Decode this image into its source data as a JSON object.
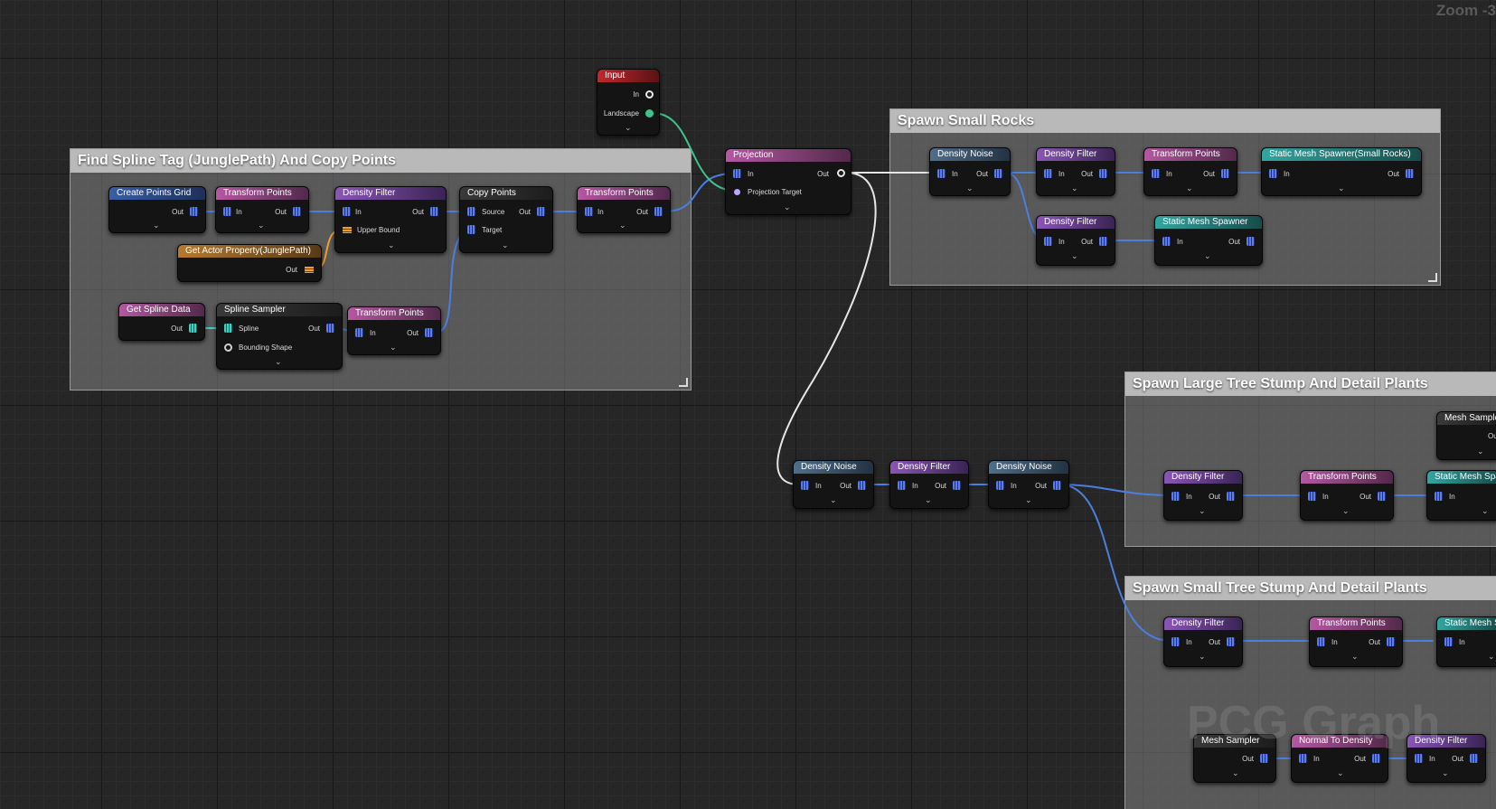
{
  "viewport": {
    "zoom_label": "Zoom -3",
    "watermark": "PCG Graph"
  },
  "colors": {
    "wire_spatial": "#4a7fe0",
    "wire_white": "#e6e6e6",
    "wire_green": "#3ec48a",
    "wire_orange": "#f0a028",
    "comment_bg": "#848484",
    "comment_title": "#b9b9b9"
  },
  "comments": [
    {
      "id": "c1",
      "title": "Find Spline Tag (JunglePath) And Copy Points"
    },
    {
      "id": "c2",
      "title": "Spawn Small Rocks"
    },
    {
      "id": "c3",
      "title": "Spawn Large Tree Stump And Detail Plants"
    },
    {
      "id": "c4",
      "title": "Spawn Small Tree Stump And Detail Plants"
    }
  ],
  "nodes": {
    "input": {
      "title": "Input",
      "pins": [
        "In",
        "Landscape"
      ]
    },
    "create_points_grid": {
      "title": "Create Points Grid",
      "pins": [
        "Out"
      ]
    },
    "transform_points_1": {
      "title": "Transform Points",
      "pins": [
        "In",
        "Out"
      ]
    },
    "density_filter_1": {
      "title": "Density Filter",
      "pins": [
        "In",
        "Out",
        "Upper Bound"
      ]
    },
    "copy_points": {
      "title": "Copy Points",
      "pins": [
        "Source",
        "Out",
        "Target"
      ]
    },
    "transform_points_2": {
      "title": "Transform Points",
      "pins": [
        "In",
        "Out"
      ]
    },
    "get_actor_property": {
      "title": "Get Actor Property(JunglePath)",
      "pins": [
        "Out"
      ]
    },
    "get_spline_data": {
      "title": "Get Spline Data",
      "pins": [
        "Out"
      ]
    },
    "spline_sampler": {
      "title": "Spline Sampler",
      "pins": [
        "Spline",
        "Out",
        "Bounding Shape"
      ]
    },
    "transform_points_3": {
      "title": "Transform Points",
      "pins": [
        "In",
        "Out"
      ]
    },
    "projection": {
      "title": "Projection",
      "pins": [
        "In",
        "Out",
        "Projection Target"
      ]
    },
    "sr_density_noise": {
      "title": "Density Noise",
      "pins": [
        "In",
        "Out"
      ]
    },
    "sr_density_filter_1": {
      "title": "Density Filter",
      "pins": [
        "In",
        "Out"
      ]
    },
    "sr_transform_points": {
      "title": "Transform Points",
      "pins": [
        "In",
        "Out"
      ]
    },
    "sr_static_mesh_spawner_rocks": {
      "title": "Static Mesh Spawner(Small Rocks)",
      "pins": [
        "In",
        "Out"
      ]
    },
    "sr_density_filter_2": {
      "title": "Density Filter",
      "pins": [
        "In",
        "Out"
      ]
    },
    "sr_static_mesh_spawner": {
      "title": "Static Mesh Spawner",
      "pins": [
        "In",
        "Out"
      ]
    },
    "m_density_noise_1": {
      "title": "Density Noise",
      "pins": [
        "In",
        "Out"
      ]
    },
    "m_density_filter": {
      "title": "Density Filter",
      "pins": [
        "In",
        "Out"
      ]
    },
    "m_density_noise_2": {
      "title": "Density Noise",
      "pins": [
        "In",
        "Out"
      ]
    },
    "lt_mesh_sampler": {
      "title": "Mesh Sampler",
      "pins": [
        "Out"
      ]
    },
    "lt_density_filter": {
      "title": "Density Filter",
      "pins": [
        "In",
        "Out"
      ]
    },
    "lt_transform_points": {
      "title": "Transform Points",
      "pins": [
        "In",
        "Out"
      ]
    },
    "lt_static_mesh_spawner": {
      "title": "Static Mesh Spawner",
      "pins": [
        "In"
      ]
    },
    "st_density_filter": {
      "title": "Density Filter",
      "pins": [
        "In",
        "Out"
      ]
    },
    "st_transform_points": {
      "title": "Transform Points",
      "pins": [
        "In",
        "Out"
      ]
    },
    "st_static_mesh_spawner": {
      "title": "Static Mesh Spawner",
      "pins": [
        "In"
      ]
    },
    "st_mesh_sampler": {
      "title": "Mesh Sampler",
      "pins": [
        "Out"
      ]
    },
    "st_normal_to_density": {
      "title": "Normal To Density",
      "pins": [
        "In",
        "Out"
      ]
    },
    "st_density_filter_2": {
      "title": "Density Filter",
      "pins": [
        "In",
        "Out"
      ]
    }
  }
}
